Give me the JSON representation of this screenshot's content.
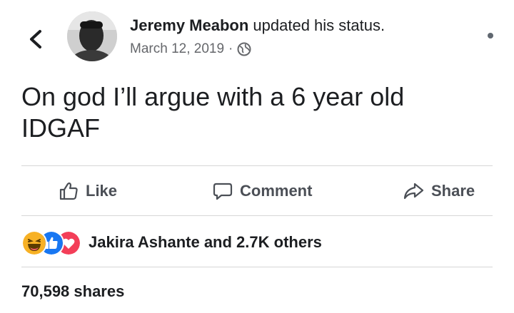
{
  "post": {
    "author_name": "Jeremy Meabon",
    "action_text": " updated his status.",
    "date": "March 12, 2019",
    "meta_separator": "·",
    "privacy_icon": "globe-icon",
    "status_line_1": "On god I’ll argue with a 6 year old",
    "status_line_2": "IDGAF"
  },
  "actions": {
    "like_label": "Like",
    "comment_label": "Comment",
    "share_label": "Share"
  },
  "reactions": {
    "icons": [
      "haha-icon",
      "like-icon",
      "love-icon"
    ],
    "summary": "Jakira Ashante and 2.7K others"
  },
  "shares": {
    "count_text": "70,598 shares"
  },
  "colors": {
    "text": "#1c1e21",
    "secondary_text": "#65676b",
    "action_text": "#4b4f56",
    "like_blue": "#1877f2",
    "love_red": "#f33e58",
    "haha_yellow": "#f7b125"
  }
}
